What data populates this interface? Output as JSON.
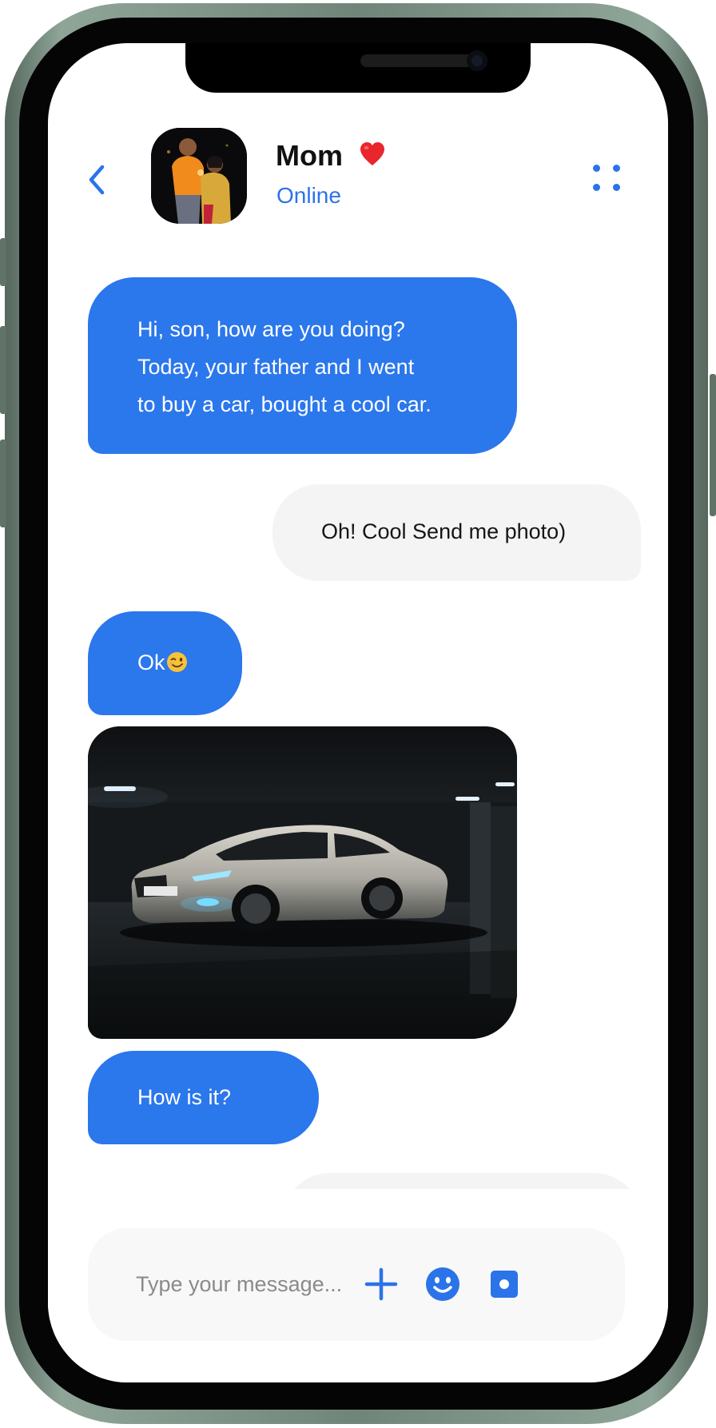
{
  "header": {
    "contact_name": "Mom",
    "status": "Online"
  },
  "messages": [
    {
      "side": "incoming",
      "lines": [
        "Hi, son, how are you doing?",
        "Today, your father and I went",
        "to buy a car, bought a cool car."
      ]
    },
    {
      "side": "outgoing",
      "text": "Oh! Cool Send me photo)"
    },
    {
      "side": "incoming",
      "text": "Ok"
    },
    {
      "side": "incoming",
      "type": "photo",
      "subject": "car"
    },
    {
      "side": "incoming",
      "text": "How is it?"
    }
  ],
  "composer": {
    "placeholder": "Type your message..."
  },
  "colors": {
    "accent": "#2b73e8",
    "incoming_bubble": "#2b77ec",
    "outgoing_bubble": "#f4f4f4",
    "frame": "#708579"
  },
  "icons": [
    "chevron-left-icon",
    "more-dots-icon",
    "heart-emoji",
    "wink-emoji",
    "plus-icon",
    "smiley-icon",
    "camera-icon"
  ]
}
